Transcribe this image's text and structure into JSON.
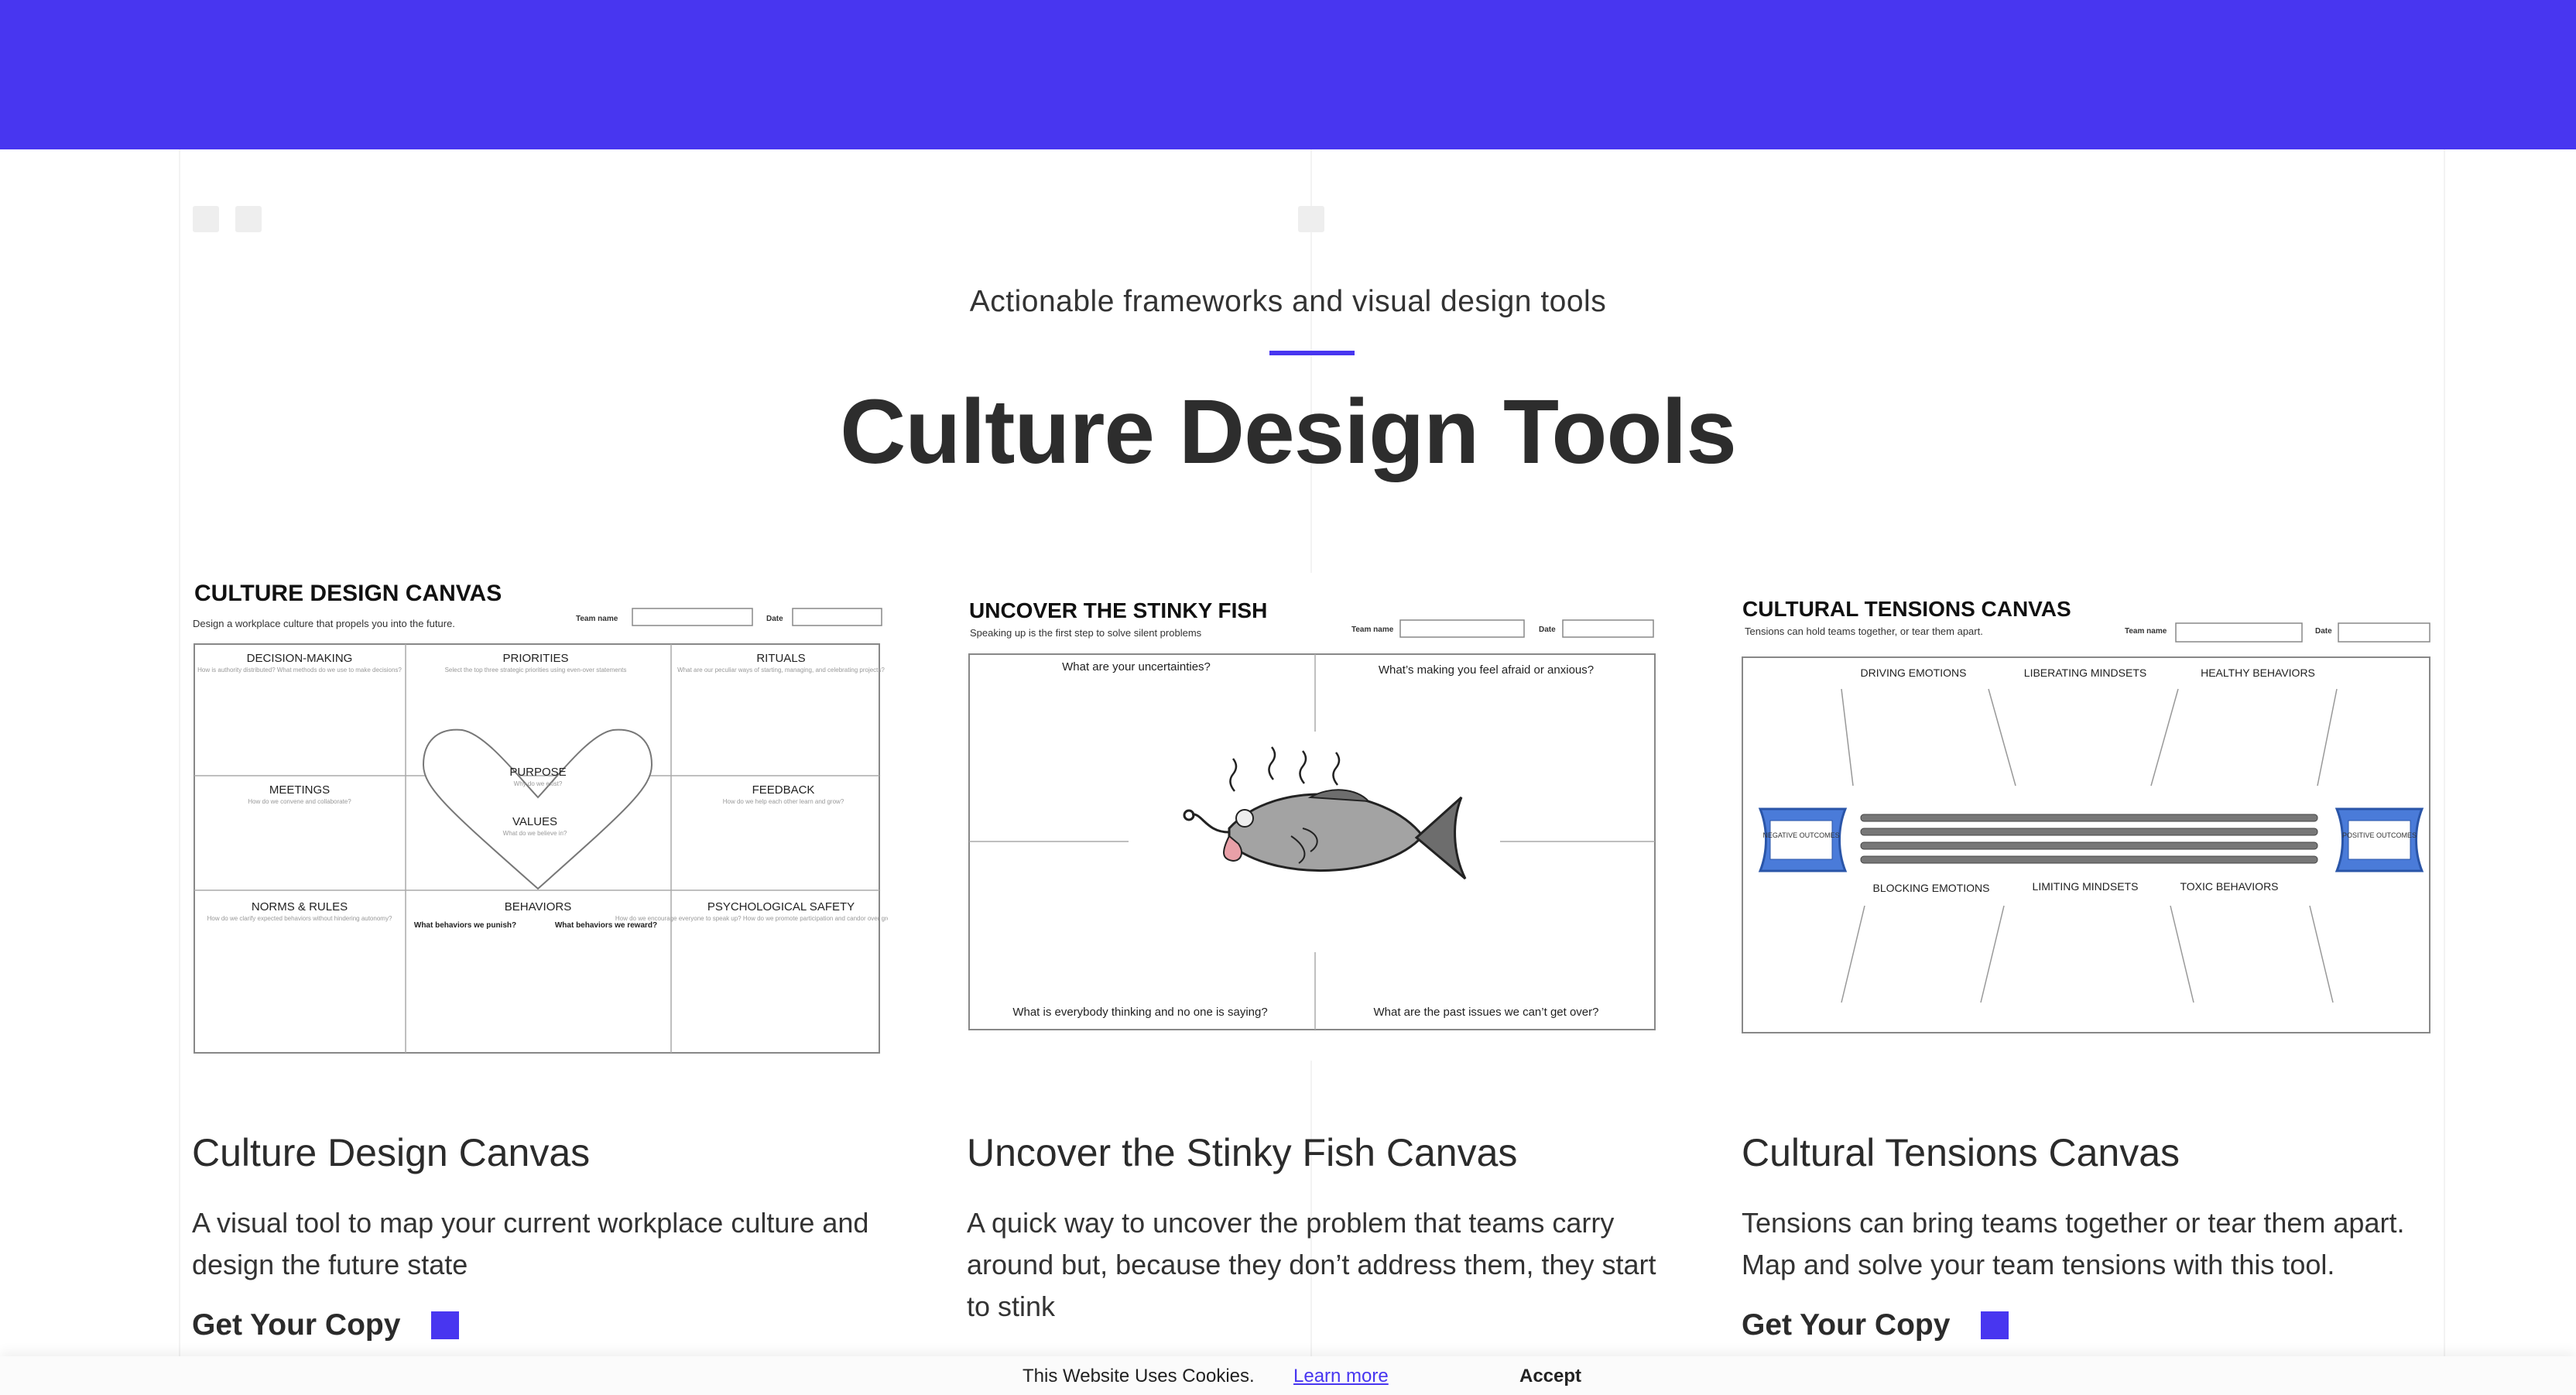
{
  "brand_color": "#4836f0",
  "header": {
    "subtitle": "Actionable frameworks and visual design tools",
    "title": "Culture Design Tools"
  },
  "cards": [
    {
      "title": "Culture Design Canvas",
      "description": "A visual tool to map your current workplace culture and design the future state",
      "cta": "Get Your Copy",
      "image": {
        "heading": "CULTURE DESIGN CANVAS",
        "tagline": "Design a workplace culture that propels you into the future.",
        "team_label": "Team name",
        "date_label": "Date",
        "cells": {
          "decision_making": "DECISION-MAKING",
          "decision_making_sub": "How is authority distributed? What methods do we use to make decisions?",
          "priorities": "PRIORITIES",
          "priorities_sub": "Select the top three strategic priorities using even-over statements",
          "rituals": "RITUALS",
          "rituals_sub": "What are our peculiar ways of starting, managing, and celebrating projects?",
          "meetings": "MEETINGS",
          "meetings_sub": "How do we convene and collaborate?",
          "purpose": "PURPOSE",
          "purpose_sub": "Why do we exist?",
          "values": "VALUES",
          "values_sub": "What do we believe in?",
          "feedback": "FEEDBACK",
          "feedback_sub": "How do we help each other learn and grow?",
          "norms": "NORMS & RULES",
          "norms_sub": "How do we clarify expected behaviors without hindering autonomy?",
          "behaviors": "BEHAVIORS",
          "behaviors_punish": "What behaviors we punish?",
          "behaviors_reward": "What behaviors we reward?",
          "psych_safety": "PSYCHOLOGICAL SAFETY",
          "psych_safety_sub": "How do we encourage everyone to speak up? How do we promote participation and candor over groupthink and silence?"
        }
      }
    },
    {
      "title": "Uncover the Stinky Fish Canvas",
      "description": "A quick way to uncover the problem that teams carry around but, because they don’t address them, they start to stink",
      "image": {
        "heading": "UNCOVER THE STINKY FISH",
        "tagline": "Speaking up is the first step to solve silent problems",
        "team_label": "Team name",
        "date_label": "Date",
        "q1": "What are your uncertainties?",
        "q2": "What’s making you feel afraid or anxious?",
        "q3": "What is everybody thinking and no one is saying?",
        "q4": "What are the past issues we can’t get over?"
      }
    },
    {
      "title": "Cultural Tensions Canvas",
      "description": "Tensions can bring teams together or tear them apart. Map and solve your team tensions with this tool.",
      "cta": "Get Your Copy",
      "image": {
        "heading": "CULTURAL TENSIONS CANVAS",
        "tagline": "Tensions can hold teams together, or tear them apart.",
        "team_label": "Team name",
        "date_label": "Date",
        "top_labels": [
          "DRIVING EMOTIONS",
          "LIBERATING MINDSETS",
          "HEALTHY BEHAVIORS"
        ],
        "bottom_labels": [
          "BLOCKING EMOTIONS",
          "LIMITING MINDSETS",
          "TOXIC BEHAVIORS"
        ],
        "left_handle": "NEGATIVE OUTCOMES",
        "right_handle": "POSITIVE OUTCOMES"
      }
    }
  ],
  "cookie_bar": {
    "message": "This Website Uses Cookies.",
    "learn_more": "Learn more",
    "accept": "Accept"
  }
}
